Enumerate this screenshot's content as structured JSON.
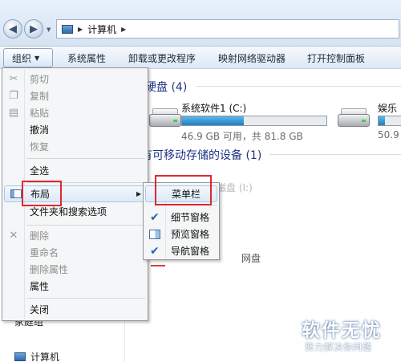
{
  "window": {
    "breadcrumb": "计算机"
  },
  "toolbar": {
    "organize": "组织",
    "system_properties": "系统属性",
    "uninstall": "卸载或更改程序",
    "map_drive": "映射网络驱动器",
    "open_control_panel": "打开控制面板"
  },
  "content": {
    "hdd_section": "硬盘 (4)",
    "removable_section": "有可移动存储的设备 (1)",
    "drives": [
      {
        "name": "系统软件1 (C:)",
        "info": "46.9 GB 可用，共 81.8 GB",
        "used_fraction": 0.43
      },
      {
        "name": "娱乐",
        "info": "50.9",
        "used_fraction": 0.3
      }
    ],
    "partial_texts": [
      "可移动磁盘 (I:)",
      "网盘"
    ]
  },
  "nav": {
    "homegroup": "家庭组",
    "computer": "计算机"
  },
  "menu": {
    "items": [
      {
        "label": "剪切",
        "icon": "cut-icon",
        "enabled": false
      },
      {
        "label": "复制",
        "icon": "copy-icon",
        "enabled": false
      },
      {
        "label": "粘贴",
        "icon": "paste-icon",
        "enabled": false
      },
      {
        "label": "撤消",
        "enabled": true
      },
      {
        "label": "恢复",
        "enabled": false
      },
      {
        "label": "全选",
        "enabled": true
      },
      {
        "label": "布局",
        "icon": "layout-icon",
        "enabled": true,
        "submenu": true
      },
      {
        "label": "文件夹和搜索选项",
        "enabled": true
      },
      {
        "label": "删除",
        "icon": "delete-icon",
        "enabled": false
      },
      {
        "label": "重命名",
        "enabled": false
      },
      {
        "label": "删除属性",
        "enabled": false
      },
      {
        "label": "属性",
        "enabled": true
      },
      {
        "label": "关闭",
        "enabled": true
      }
    ]
  },
  "submenu": {
    "items": [
      {
        "label": "菜单栏",
        "checked": false
      },
      {
        "label": "细节窗格",
        "checked": true
      },
      {
        "label": "预览窗格",
        "checked": false,
        "icon": "preview-pane-icon"
      },
      {
        "label": "导航窗格",
        "checked": true
      }
    ]
  },
  "watermark": {
    "title": "软件无忧",
    "subtitle": "努力解决你问题"
  },
  "colors": {
    "annotation_red": "#e0282d",
    "section_title": "#1e3287",
    "drive_bar": "#1f7fc0"
  }
}
